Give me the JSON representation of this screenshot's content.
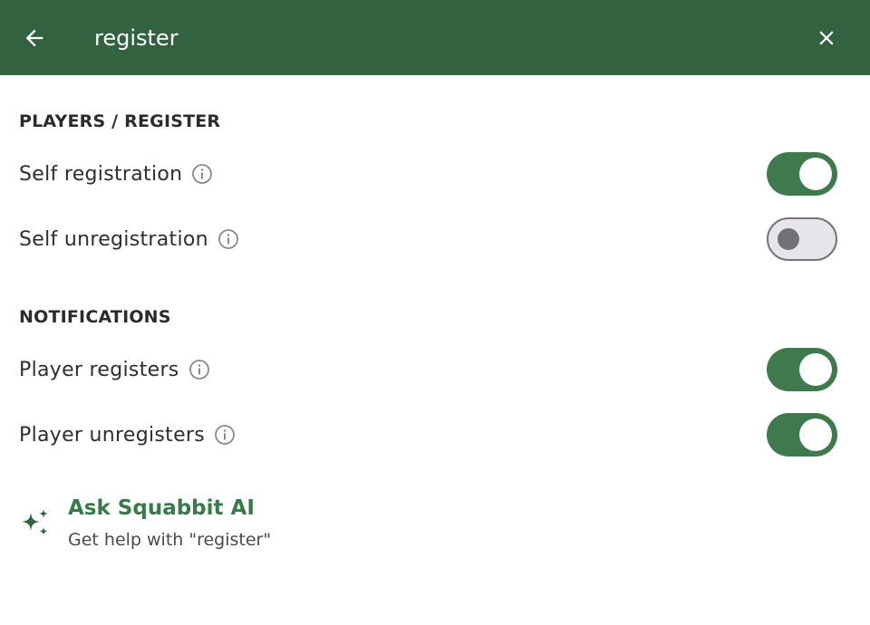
{
  "search": {
    "query": "register",
    "back_icon": "arrow-left-icon",
    "close_icon": "close-icon"
  },
  "sections": {
    "players_register": {
      "title": "PLAYERS / REGISTER",
      "rows": [
        {
          "label": "Self registration",
          "enabled": true
        },
        {
          "label": "Self unregistration",
          "enabled": false
        }
      ]
    },
    "notifications": {
      "title": "NOTIFICATIONS",
      "rows": [
        {
          "label": "Player registers",
          "enabled": true
        },
        {
          "label": "Player unregisters",
          "enabled": true
        }
      ]
    }
  },
  "ai": {
    "title": "Ask Squabbit AI",
    "subtitle": "Get help with \"register\"",
    "icon": "sparkle-icon"
  },
  "colors": {
    "header_bg": "#336241",
    "accent": "#3f7a4d",
    "ai_title": "#3a7a4a"
  }
}
